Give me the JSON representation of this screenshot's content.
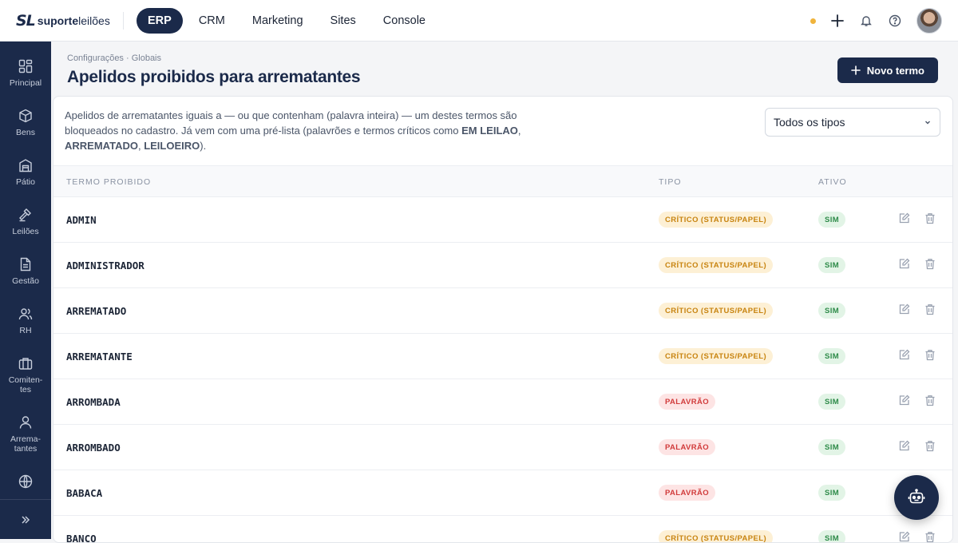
{
  "brand": {
    "mark": "SL",
    "name_bold": "suporte",
    "name_light": "leilões"
  },
  "topnav": [
    {
      "label": "ERP",
      "active": true
    },
    {
      "label": "CRM",
      "active": false
    },
    {
      "label": "Marketing",
      "active": false
    },
    {
      "label": "Sites",
      "active": false
    },
    {
      "label": "Console",
      "active": false
    }
  ],
  "sidebar": [
    {
      "label": "Principal",
      "icon": "grid-icon"
    },
    {
      "label": "Bens",
      "icon": "box-icon"
    },
    {
      "label": "Pátio",
      "icon": "warehouse-icon"
    },
    {
      "label": "Leilões",
      "icon": "gavel-icon"
    },
    {
      "label": "Gestão",
      "icon": "document-icon"
    },
    {
      "label": "RH",
      "icon": "users-icon"
    },
    {
      "label": "Comiten-\ntes",
      "icon": "briefcase-icon"
    },
    {
      "label": "Arrema-\ntantes",
      "icon": "user-icon"
    },
    {
      "label": "",
      "icon": "globe-icon"
    }
  ],
  "page": {
    "breadcrumb": "Configurações · Globais",
    "title": "Apelidos proibidos para arrematantes",
    "new_button": "Novo termo",
    "desc_part1": "Apelidos de arrematantes iguais a — ou que contenham (palavra inteira) — um destes termos são bloqueados no cadastro. Já vem com uma pré-lista (palavrões e termos críticos como ",
    "desc_bold1": "EM LEILAO",
    "desc_sep1": ", ",
    "desc_bold2": "ARREMATADO",
    "desc_sep2": ", ",
    "desc_bold3": "LEILOEIRO",
    "desc_end": ").",
    "filter_value": "Todos os tipos"
  },
  "table": {
    "columns": [
      "TERMO PROIBIDO",
      "TIPO",
      "ATIVO"
    ],
    "rows": [
      {
        "term": "ADMIN",
        "type": "CRÍTICO (STATUS/PAPEL)",
        "kind": "crit",
        "active": "SIM"
      },
      {
        "term": "ADMINISTRADOR",
        "type": "CRÍTICO (STATUS/PAPEL)",
        "kind": "crit",
        "active": "SIM"
      },
      {
        "term": "ARREMATADO",
        "type": "CRÍTICO (STATUS/PAPEL)",
        "kind": "crit",
        "active": "SIM"
      },
      {
        "term": "ARREMATANTE",
        "type": "CRÍTICO (STATUS/PAPEL)",
        "kind": "crit",
        "active": "SIM"
      },
      {
        "term": "ARROMBADA",
        "type": "PALAVRÃO",
        "kind": "pal",
        "active": "SIM"
      },
      {
        "term": "ARROMBADO",
        "type": "PALAVRÃO",
        "kind": "pal",
        "active": "SIM"
      },
      {
        "term": "BABACA",
        "type": "PALAVRÃO",
        "kind": "pal",
        "active": "SIM"
      },
      {
        "term": "BANCO",
        "type": "CRÍTICO (STATUS/PAPEL)",
        "kind": "crit",
        "active": "SIM"
      }
    ]
  },
  "colors": {
    "navy": "#1b2a4a",
    "critical": "#c88410",
    "swear": "#d13b3b",
    "active": "#2e8b49",
    "dot": "#f0b43c"
  }
}
